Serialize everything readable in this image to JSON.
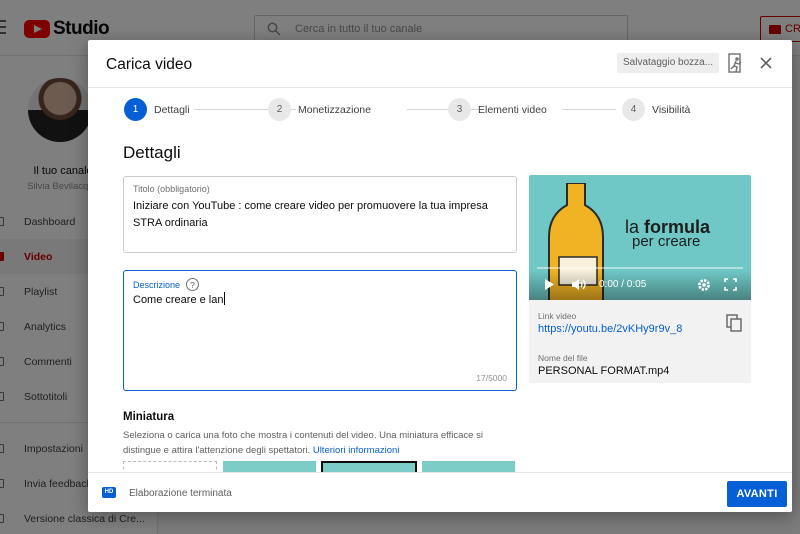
{
  "studio": {
    "logo_text": "Studio",
    "search_placeholder": "Cerca in tutto il tuo canale",
    "create_label": "CR",
    "channel_name": "Il tuo canale",
    "channel_owner": "Silvia Bevilacqua",
    "nav": [
      {
        "label": "Dashboard",
        "icon": "dashboard-icon"
      },
      {
        "label": "Video",
        "icon": "video-icon",
        "active": true
      },
      {
        "label": "Playlist",
        "icon": "playlist-icon"
      },
      {
        "label": "Analytics",
        "icon": "analytics-icon"
      },
      {
        "label": "Commenti",
        "icon": "comments-icon"
      },
      {
        "label": "Sottotitoli",
        "icon": "subtitles-icon"
      }
    ],
    "nav_bottom": [
      {
        "label": "Impostazioni",
        "icon": "settings-icon"
      },
      {
        "label": "Invia feedback",
        "icon": "feedback-icon"
      },
      {
        "label": "Versione classica di Cre...",
        "icon": "classic-icon"
      }
    ]
  },
  "dialog": {
    "title": "Carica video",
    "save_status": "Salvataggio bozza...",
    "steps": [
      {
        "num": "1",
        "label": "Dettagli",
        "active": true
      },
      {
        "num": "2",
        "label": "Monetizzazione"
      },
      {
        "num": "3",
        "label": "Elementi video"
      },
      {
        "num": "4",
        "label": "Visibilità"
      }
    ],
    "section_title": "Dettagli",
    "title_field": {
      "label": "Titolo (obbligatorio)",
      "value": "Iniziare con YouTube : come creare video per promuovere la tua impresa STRA ordinaria"
    },
    "description_field": {
      "label": "Descrizione",
      "help": "?",
      "value": "Come creare e lan",
      "counter": "17/5000"
    },
    "thumbnail": {
      "title": "Miniatura",
      "description": "Seleziona o carica una foto che mostra i contenuti del video. Una miniatura efficace si distingue e attira l'attenzione degli spettatori.",
      "link": "Ulteriori informazioni"
    },
    "video": {
      "overlay_line1_a": "la ",
      "overlay_line1_b": "formula",
      "overlay_line2": "per creare",
      "time": "0:00 / 0:05",
      "link_label": "Link video",
      "link": "https://youtu.be/2vKHy9r9v_8",
      "file_label": "Nome del file",
      "file_name": "PERSONAL FORMAT.mp4"
    },
    "footer": {
      "hd_badge": "HD",
      "status": "Elaborazione terminata",
      "next_label": "AVANTI"
    },
    "accent_color": "#065fd4"
  }
}
